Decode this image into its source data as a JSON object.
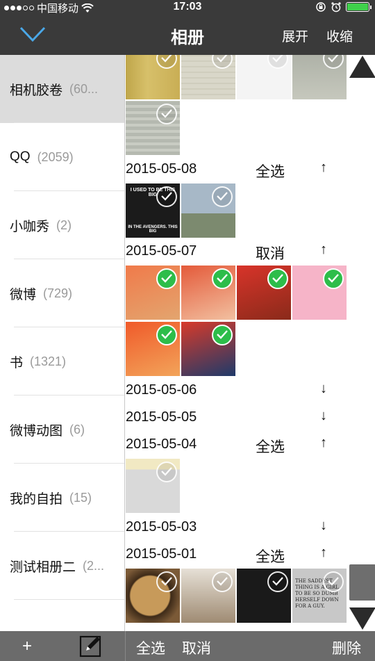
{
  "status_bar": {
    "carrier": "中国移动",
    "time": "17:03"
  },
  "nav": {
    "title": "相册",
    "expand_label": "展开",
    "collapse_label": "收缩"
  },
  "albums": [
    {
      "name": "相机胶卷",
      "count": "(60..."
    },
    {
      "name": "QQ",
      "count": "(2059)"
    },
    {
      "name": "小咖秀",
      "count": "(2)"
    },
    {
      "name": "微博",
      "count": "(729)"
    },
    {
      "name": "书",
      "count": "(1321)"
    },
    {
      "name": "微博动图",
      "count": "(6)"
    },
    {
      "name": "我的自拍",
      "count": "(15)"
    },
    {
      "name": "测试相册二",
      "count": "(2..."
    }
  ],
  "groups": [
    {
      "date": "2015-05-08",
      "action": "全选",
      "arrow": "↑"
    },
    {
      "date": "2015-05-07",
      "action": "取消",
      "arrow": "↑"
    },
    {
      "date": "2015-05-06",
      "action": "",
      "arrow": "↓"
    },
    {
      "date": "2015-05-05",
      "action": "",
      "arrow": "↓"
    },
    {
      "date": "2015-05-04",
      "action": "全选",
      "arrow": "↑"
    },
    {
      "date": "2015-05-03",
      "action": "",
      "arrow": "↓"
    },
    {
      "date": "2015-05-01",
      "action": "全选",
      "arrow": "↑"
    }
  ],
  "thumbnails": {
    "row0": [
      {
        "kind": "door",
        "selected": false
      },
      {
        "kind": "book",
        "selected": false
      },
      {
        "kind": "comic",
        "selected": false
      },
      {
        "kind": "book",
        "selected": false
      }
    ],
    "row1": [
      {
        "kind": "page",
        "selected": false
      }
    ],
    "g0508": [
      {
        "kind": "meme",
        "selected": false
      },
      {
        "kind": "city",
        "selected": false
      }
    ],
    "g0507": [
      {
        "kind": "anime",
        "selected": true
      },
      {
        "kind": "anime",
        "selected": true
      },
      {
        "kind": "anime",
        "selected": true
      },
      {
        "kind": "anime",
        "selected": true
      },
      {
        "kind": "anime",
        "selected": true
      },
      {
        "kind": "anime",
        "selected": true
      }
    ],
    "g0504": [
      {
        "kind": "blurred",
        "selected": false
      }
    ],
    "g0501": [
      {
        "kind": "food",
        "selected": false
      },
      {
        "kind": "portrait",
        "selected": false
      },
      {
        "kind": "dark",
        "selected": false
      },
      {
        "kind": "quote",
        "selected": false
      }
    ]
  },
  "meme_text": {
    "top": "I USED TO BE THIS BIG",
    "bottom": "IN THE AVENGERS. THIS BIG"
  },
  "quote_text": "THE SADDEST THING IS A GIRL TO BE SO DUMB HERSELF DOWN FOR A GUY.",
  "toolbar": {
    "add_label": "+",
    "select_all_label": "全选",
    "cancel_label": "取消",
    "delete_label": "删除"
  },
  "colors": {
    "bar_bg": "#3a3a3a",
    "toolbar_bg": "#6b6b6b",
    "selected_check": "#2dbd4a",
    "active_album_bg": "#dcdcdc"
  }
}
